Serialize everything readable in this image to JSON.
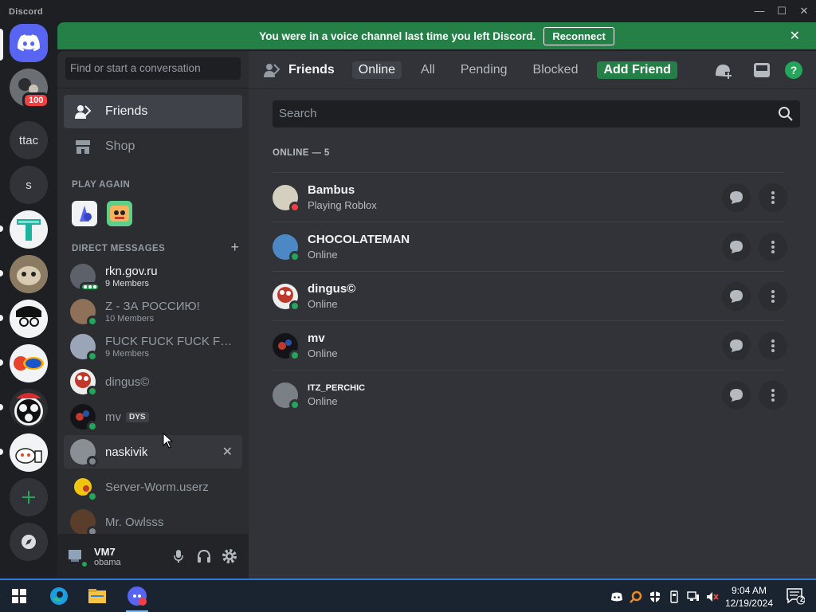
{
  "window": {
    "title": "Discord",
    "minimize": "—",
    "maximize": "☐",
    "close": "✕"
  },
  "banner": {
    "message": "You were in a voice channel last time you left Discord.",
    "button": "Reconnect",
    "close": "✕"
  },
  "rail": {
    "badge": "100",
    "servers": [
      {
        "name": "ttac"
      },
      {
        "name": "s"
      }
    ]
  },
  "sidebar": {
    "search_placeholder": "Find or start a conversation",
    "nav": [
      {
        "label": "Friends"
      },
      {
        "label": "Shop"
      }
    ],
    "play_again_header": "PLAY AGAIN",
    "dm_header": "DIRECT MESSAGES",
    "dm_add": "+",
    "dms": [
      {
        "name": "rkn.gov.ru",
        "sub": "9 Members"
      },
      {
        "name": "Z - ЗА РОССИЮ!",
        "sub": "10 Members"
      },
      {
        "name": "FUCK FUCK FUCK FU...",
        "sub": "9 Members"
      },
      {
        "name": "dingus©",
        "sub": ""
      },
      {
        "name": "mv",
        "sub": "",
        "tag": "DYS"
      },
      {
        "name": "naskivik",
        "sub": ""
      },
      {
        "name": "Server-Worm.userz",
        "sub": ""
      },
      {
        "name": "Mr. Owlsss",
        "sub": ""
      }
    ],
    "close_dm": "✕",
    "user": {
      "name": "VM7",
      "status": "obama"
    }
  },
  "main": {
    "title": "Friends",
    "tabs": [
      {
        "label": "Online"
      },
      {
        "label": "All"
      },
      {
        "label": "Pending"
      },
      {
        "label": "Blocked"
      },
      {
        "label": "Add Friend"
      }
    ],
    "search_placeholder": "Search",
    "online_header": "ONLINE — 5",
    "friends": [
      {
        "name": "Bambus",
        "status": "Playing Roblox"
      },
      {
        "name": "CHOCOLATEMAN",
        "status": "Online"
      },
      {
        "name": "dingus©",
        "status": "Online"
      },
      {
        "name": "mv",
        "status": "Online"
      },
      {
        "name": "ITZ_PERCHIC",
        "status": "Online"
      }
    ]
  },
  "taskbar": {
    "time": "9:04 AM",
    "date": "12/19/2024",
    "notifications": "2"
  },
  "colors": {
    "accent": "#5865f2",
    "green": "#248046",
    "online": "#23a55a",
    "dnd": "#f23f43"
  }
}
